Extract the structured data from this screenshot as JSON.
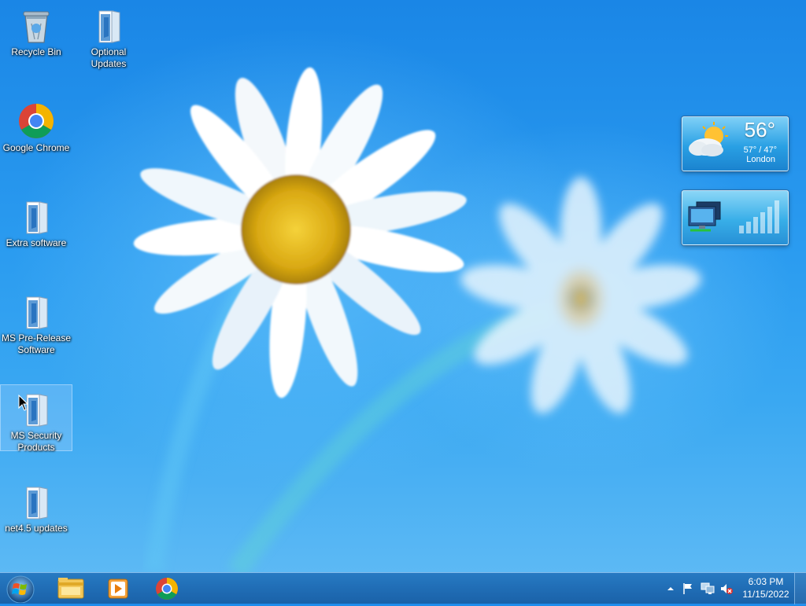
{
  "desktop": {
    "icons": [
      {
        "label": "Recycle Bin"
      },
      {
        "label": "Optional Updates"
      },
      {
        "label": "Google Chrome"
      },
      {
        "label": "Extra software"
      },
      {
        "label": "MS Pre-Release Software"
      },
      {
        "label": "MS Security Products"
      },
      {
        "label": "net4.5 updates"
      }
    ]
  },
  "gadgets": {
    "weather": {
      "temperature": "56°",
      "range": "57° / 47°",
      "city": "London",
      "icon": "partly-cloudy-icon"
    },
    "network": {
      "icon": "network-monitor-icon"
    }
  },
  "taskbar": {
    "start_icon": "windows-logo-icon",
    "pinned": [
      {
        "icon": "file-explorer-icon"
      },
      {
        "icon": "media-player-icon"
      },
      {
        "icon": "chrome-icon"
      }
    ],
    "tray": [
      {
        "icon": "show-hidden-icons-icon"
      },
      {
        "icon": "action-center-flag-icon"
      },
      {
        "icon": "network-icon"
      },
      {
        "icon": "volume-muted-icon"
      }
    ],
    "clock": {
      "time": "6:03 PM",
      "date": "11/15/2022"
    }
  },
  "colors": {
    "taskbar": "#1f6fb5",
    "wallpaper": "#2b9cf0"
  }
}
